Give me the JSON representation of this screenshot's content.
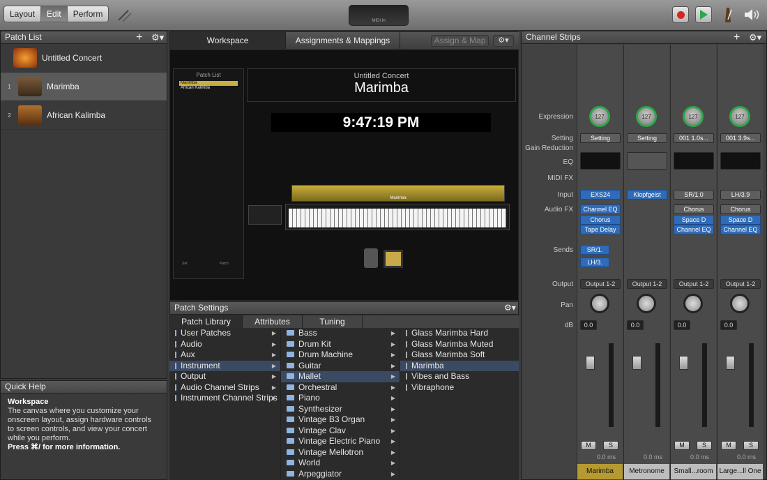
{
  "toolbar": {
    "modes": [
      "Layout",
      "Edit",
      "Perform"
    ],
    "selected_mode": "Edit",
    "lcd_label": "MIDI In"
  },
  "patch_list": {
    "title": "Patch List",
    "concert": "Untitled Concert",
    "patches": [
      {
        "num": "1",
        "name": "Marimba"
      },
      {
        "num": "2",
        "name": "African Kalimba"
      }
    ]
  },
  "quick_help": {
    "title": "Quick Help",
    "heading": "Workspace",
    "body": "The canvas where you customize your onscreen layout, assign hardware controls to screen controls, and view your concert while you perform.",
    "hint": "Press ⌘/ for more information."
  },
  "workspace": {
    "tabs": [
      "Workspace",
      "Assignments & Mappings"
    ],
    "assign_button": "Assign & Map",
    "mini_list_title": "Patch List",
    "mini_items": [
      "Marimba",
      "African Kalimba"
    ],
    "mini_set": "Set",
    "mini_patch": "Patch",
    "concert_name": "Untitled Concert",
    "patch_name": "Marimba",
    "clock": "9:47:19 PM",
    "keyboard_label": "Marimba"
  },
  "patch_settings": {
    "title": "Patch Settings",
    "tabs": [
      "Patch Library",
      "Attributes",
      "Tuning"
    ],
    "col1": [
      "User Patches",
      "Audio",
      "Aux",
      "Instrument",
      "Output",
      "Audio Channel Strips",
      "Instrument Channel Strips"
    ],
    "col2": [
      "Bass",
      "Drum Kit",
      "Drum Machine",
      "Guitar",
      "Mallet",
      "Orchestral",
      "Piano",
      "Synthesizer",
      "Vintage B3 Organ",
      "Vintage Clav",
      "Vintage Electric Piano",
      "Vintage Mellotron",
      "World",
      "Arpeggiator"
    ],
    "col3": [
      "Glass Marimba Hard",
      "Glass Marimba Muted",
      "Glass Marimba Soft",
      "Marimba",
      "Vibes and Bass",
      "Vibraphone"
    ]
  },
  "channel_strips": {
    "title": "Channel Strips",
    "labels": {
      "expression": "Expression",
      "setting": "Setting",
      "gain": "Gain Reduction",
      "eq": "EQ",
      "midifx": "MIDI FX",
      "input": "Input",
      "audiofx": "Audio FX",
      "sends": "Sends",
      "output": "Output",
      "pan": "Pan",
      "db": "dB"
    },
    "strips": [
      {
        "name": "Marimba",
        "expr": "127",
        "setting": "Setting",
        "input": "EXS24",
        "fx": [
          "Channel EQ",
          "Chorus",
          "Tape Delay"
        ],
        "sends": [
          "SR/1.",
          "LH/3."
        ],
        "output": "Output 1-2",
        "db": "0.0",
        "ms": "0.0 ms"
      },
      {
        "name": "Metronome",
        "expr": "127",
        "setting": "Setting",
        "input": "Klopfgeist",
        "fx": [],
        "sends": [],
        "output": "Output 1-2",
        "db": "0.0",
        "ms": "0.0 ms"
      },
      {
        "name": "Small...room",
        "expr": "127",
        "setting": "001 1.0s...",
        "input": "SR/1.0",
        "fx": [
          "Chorus",
          "Space D",
          "Channel EQ"
        ],
        "sends": [],
        "output": "Output 1-2",
        "db": "0.0",
        "ms": "0.0 ms"
      },
      {
        "name": "Large...ll One",
        "expr": "127",
        "setting": "001 3.9s...",
        "input": "LH/3.9",
        "fx": [
          "Chorus",
          "Space D",
          "Channel EQ"
        ],
        "sends": [],
        "output": "Output 1-2",
        "db": "0.0",
        "ms": "0.0 ms"
      }
    ],
    "mute": "M",
    "solo": "S"
  }
}
